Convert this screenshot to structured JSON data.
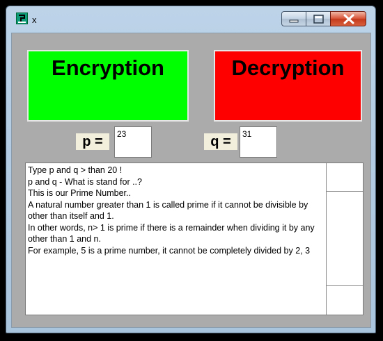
{
  "window": {
    "title": "x"
  },
  "buttons": {
    "encryption": "Encryption",
    "decryption": "Decryption"
  },
  "inputs": {
    "p": {
      "label": "p =",
      "value": "23"
    },
    "q": {
      "label": "q =",
      "value": "31"
    }
  },
  "memo": {
    "text": "Type p and q > than 20 !\np and q - What is stand for ..?\nThis is our Prime Number..\nA natural number greater than 1 is called prime if it cannot be divisible by\nother than itself and 1.\nIn other words, n> 1 is prime if there is a remainder when dividing it by any\nother than 1 and n.\nFor example, 5 is a prime number, it cannot be completely divided by 2, 3"
  },
  "colors": {
    "encryption": "#00ff00",
    "decryption": "#ff0000",
    "client_bg": "#ababab"
  }
}
